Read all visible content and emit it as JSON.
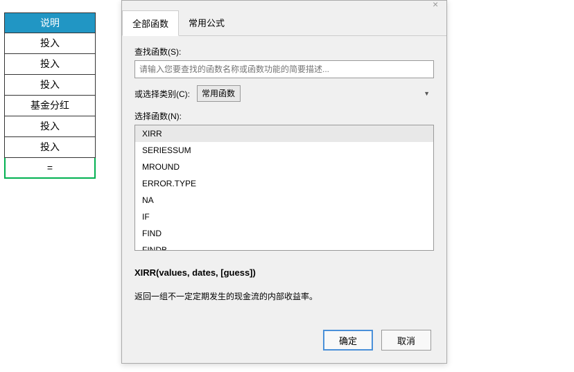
{
  "spreadsheet": {
    "header": "说明",
    "cells": [
      "投入",
      "投入",
      "投入",
      "基金分红",
      "投入",
      "投入",
      "="
    ]
  },
  "dialog": {
    "tabs": {
      "all": "全部函数",
      "common": "常用公式"
    },
    "search": {
      "label": "查找函数(S):",
      "placeholder": "请输入您要查找的函数名称或函数功能的简要描述..."
    },
    "category": {
      "label": "或选择类别(C):",
      "selected": "常用函数"
    },
    "list_label": "选择函数(N):",
    "functions": [
      "XIRR",
      "SERIESSUM",
      "MROUND",
      "ERROR.TYPE",
      "NA",
      "IF",
      "FIND",
      "FINDB"
    ],
    "signature": "XIRR(values, dates, [guess])",
    "description": "返回一组不一定定期发生的现金流的内部收益率。",
    "buttons": {
      "ok": "确定",
      "cancel": "取消"
    }
  }
}
